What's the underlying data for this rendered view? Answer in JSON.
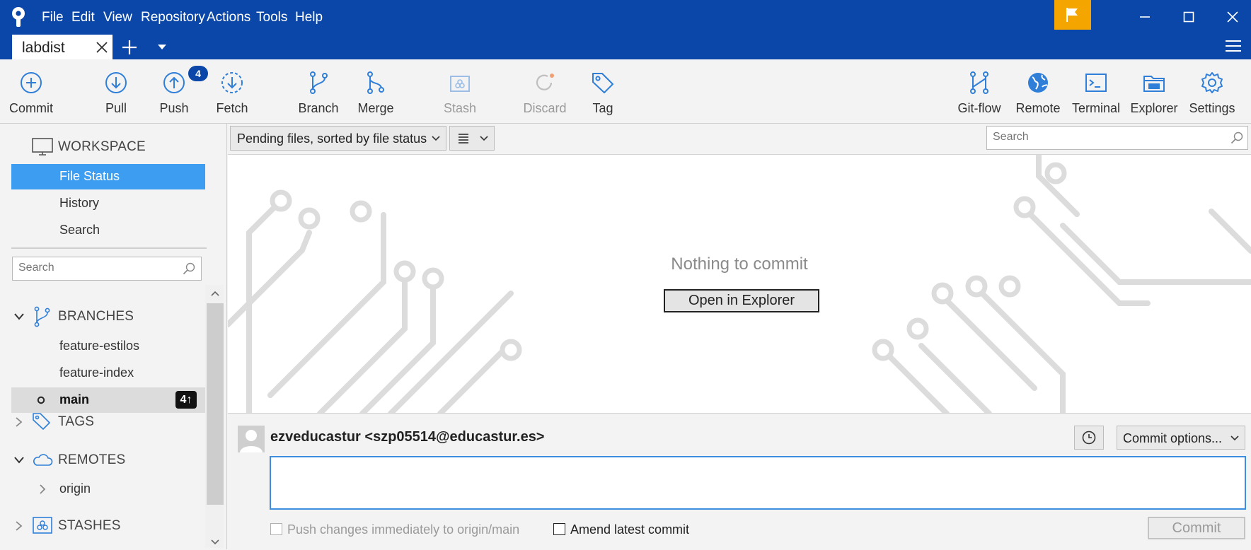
{
  "menu": [
    "File",
    "Edit",
    "View",
    "Repository",
    "Actions",
    "Tools",
    "Help"
  ],
  "tab": {
    "label": "labdist"
  },
  "toolbar": {
    "commit": "Commit",
    "pull": "Pull",
    "push": "Push",
    "push_badge": "4",
    "fetch": "Fetch",
    "branch": "Branch",
    "merge": "Merge",
    "stash": "Stash",
    "discard": "Discard",
    "tag": "Tag",
    "gitflow": "Git-flow",
    "remote": "Remote",
    "terminal": "Terminal",
    "explorer": "Explorer",
    "settings": "Settings"
  },
  "sidebar": {
    "workspace": "WORKSPACE",
    "workspace_items": [
      "File Status",
      "History",
      "Search"
    ],
    "search_placeholder": "Search",
    "branches": "BRANCHES",
    "branch_items": [
      "feature-estilos",
      "feature-index",
      "main"
    ],
    "ahead_badge": "4↑",
    "tags": "TAGS",
    "remotes": "REMOTES",
    "remote_items": [
      "origin"
    ],
    "stashes": "STASHES"
  },
  "filter": {
    "sort_label": "Pending files, sorted by file status",
    "view_icon": "list-icon",
    "search_placeholder": "Search"
  },
  "file_panel": {
    "empty_message": "Nothing to commit",
    "open_button": "Open in Explorer"
  },
  "commit_panel": {
    "author": "ezveducastur <szp05514@educastur.es>",
    "options_label": "Commit options...",
    "message_value": "",
    "push_immediately": "Push changes immediately to origin/main",
    "amend": "Amend latest commit",
    "commit_button": "Commit"
  },
  "colors": {
    "titlebar": "#0a47a9",
    "selection": "#3d9df0",
    "accent": "#2f7fd9",
    "flag": "#f5a500"
  }
}
